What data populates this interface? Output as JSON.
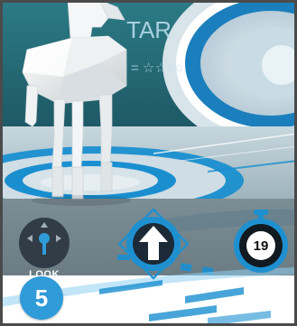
{
  "background": {
    "wall_text": "TAR",
    "formula": "= ☆☆○○"
  },
  "controls": {
    "look": {
      "label": "LOOK",
      "icon": "joystick-icon"
    },
    "move": {
      "icon": "arrow-up-icon"
    },
    "timer": {
      "value": "19",
      "icon": "stopwatch-icon",
      "remaining_fraction": 0.82
    }
  },
  "level": {
    "number": "5"
  },
  "colors": {
    "accent": "#1e90d0",
    "dark": "#1c2a36",
    "badge": "#2f9bd9"
  }
}
